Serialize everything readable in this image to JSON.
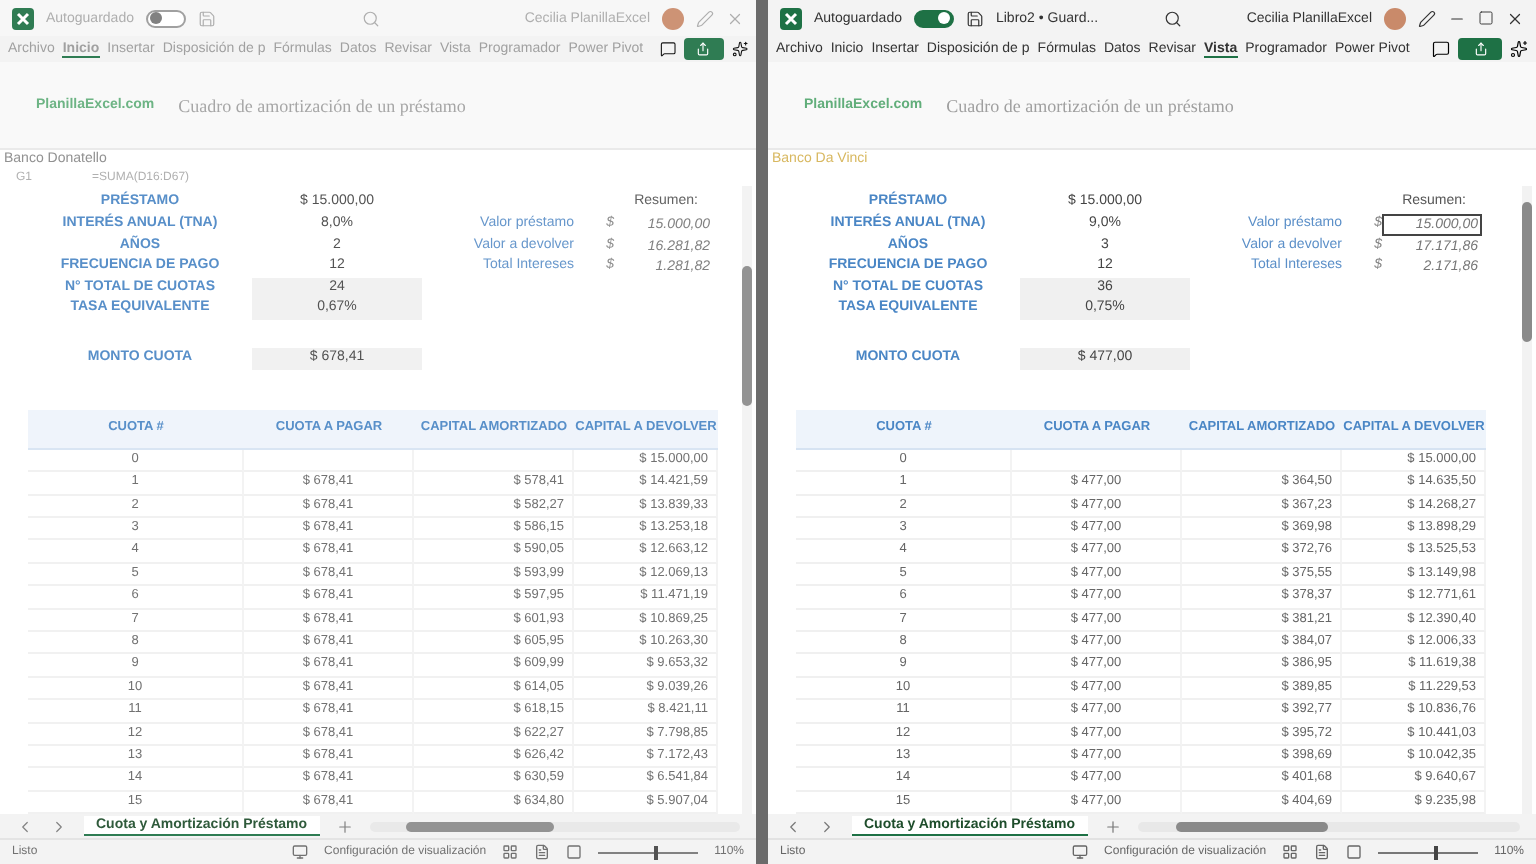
{
  "windows": [
    {
      "active": false,
      "title_bar": {
        "autosave_label": "Autoguardado",
        "autosave_on": false,
        "user_name": "Cecilia PlanillaExcel"
      },
      "ribbon_tabs": [
        {
          "label": "Archivo",
          "selected": false
        },
        {
          "label": "Inicio",
          "selected": true
        },
        {
          "label": "Insertar",
          "selected": false
        },
        {
          "label": "Disposición de p",
          "selected": false
        },
        {
          "label": "Fórmulas",
          "selected": false
        },
        {
          "label": "Datos",
          "selected": false
        },
        {
          "label": "Revisar",
          "selected": false
        },
        {
          "label": "Vista",
          "selected": false
        },
        {
          "label": "Programador",
          "selected": false
        },
        {
          "label": "Power Pivot",
          "selected": false
        }
      ],
      "ribbon": {
        "site": "PlanillaExcel.com",
        "heading": "Cuadro de amortización de un préstamo"
      },
      "bank_name": "Banco Donatello",
      "formula_bar": {
        "cell": "G1",
        "formula": "=SUMA(D16:D67)"
      },
      "loan": [
        {
          "label": "PRÉSTAMO",
          "value": "$ 15.000,00",
          "shaded": false
        },
        {
          "label": "INTERÉS ANUAL (TNA)",
          "value": "8,0%",
          "shaded": false
        },
        {
          "label": "AÑOS",
          "value": "2",
          "shaded": false
        },
        {
          "label": "FRECUENCIA DE PAGO",
          "value": "12",
          "shaded": false
        },
        {
          "label": "N° TOTAL DE CUOTAS",
          "value": "24",
          "shaded": true
        },
        {
          "label": "TASA EQUIVALENTE",
          "value": "0,67%",
          "shaded": true
        }
      ],
      "summary": {
        "title": "Resumen:",
        "items": [
          {
            "label": "Valor préstamo",
            "currency": "$",
            "value": "15.000,00",
            "selected": false
          },
          {
            "label": "Valor a devolver",
            "currency": "$",
            "value": "16.281,82",
            "selected": false
          },
          {
            "label": "Total Intereses",
            "currency": "$",
            "value": "1.281,82",
            "selected": false
          }
        ]
      },
      "payment": {
        "label": "MONTO CUOTA",
        "value": "$ 678,41"
      },
      "table": {
        "columns": [
          "CUOTA #",
          "CUOTA A PAGAR",
          "CAPITAL AMORTIZADO",
          "CAPITAL A DEVOLVER"
        ],
        "rows": [
          {
            "n": "0",
            "balance": "$ 15.000,00"
          },
          {
            "n": "1",
            "pay": "$ 678,41",
            "principal": "$ 578,41",
            "balance": "$ 14.421,59"
          },
          {
            "n": "2",
            "pay": "$ 678,41",
            "principal": "$ 582,27",
            "balance": "$ 13.839,33"
          },
          {
            "n": "3",
            "pay": "$ 678,41",
            "principal": "$ 586,15",
            "balance": "$ 13.253,18"
          },
          {
            "n": "4",
            "pay": "$ 678,41",
            "principal": "$ 590,05",
            "balance": "$ 12.663,12"
          },
          {
            "n": "5",
            "pay": "$ 678,41",
            "principal": "$ 593,99",
            "balance": "$ 12.069,13"
          },
          {
            "n": "6",
            "pay": "$ 678,41",
            "principal": "$ 597,95",
            "balance": "$ 11.471,19"
          },
          {
            "n": "7",
            "pay": "$ 678,41",
            "principal": "$ 601,93",
            "balance": "$ 10.869,25"
          },
          {
            "n": "8",
            "pay": "$ 678,41",
            "principal": "$ 605,95",
            "balance": "$ 10.263,30"
          },
          {
            "n": "9",
            "pay": "$ 678,41",
            "principal": "$ 609,99",
            "balance": "$ 9.653,32"
          },
          {
            "n": "10",
            "pay": "$ 678,41",
            "principal": "$ 614,05",
            "balance": "$ 9.039,26"
          },
          {
            "n": "11",
            "pay": "$ 678,41",
            "principal": "$ 618,15",
            "balance": "$ 8.421,11"
          },
          {
            "n": "12",
            "pay": "$ 678,41",
            "principal": "$ 622,27",
            "balance": "$ 7.798,85"
          },
          {
            "n": "13",
            "pay": "$ 678,41",
            "principal": "$ 626,42",
            "balance": "$ 7.172,43"
          },
          {
            "n": "14",
            "pay": "$ 678,41",
            "principal": "$ 630,59",
            "balance": "$ 6.541,84"
          },
          {
            "n": "15",
            "pay": "$ 678,41",
            "principal": "$ 634,80",
            "balance": "$ 5.907,04"
          }
        ]
      },
      "sheet_tab": {
        "label": "Cuota y Amortización Préstamo",
        "selected": true
      },
      "status": {
        "ready": "Listo",
        "display_settings": "Configuración de visualización",
        "zoom": {
          "level": 0.55,
          "reading": "110%"
        }
      }
    },
    {
      "active": true,
      "title_bar": {
        "autosave_label": "Autoguardado",
        "autosave_on": true,
        "file_name": "Libro2 • Guard...",
        "user_name": "Cecilia PlanillaExcel"
      },
      "ribbon_tabs": [
        {
          "label": "Archivo",
          "selected": false
        },
        {
          "label": "Inicio",
          "selected": false
        },
        {
          "label": "Insertar",
          "selected": false
        },
        {
          "label": "Disposición de p",
          "selected": false
        },
        {
          "label": "Fórmulas",
          "selected": false
        },
        {
          "label": "Datos",
          "selected": false
        },
        {
          "label": "Revisar",
          "selected": false
        },
        {
          "label": "Vista",
          "selected": true
        },
        {
          "label": "Programador",
          "selected": false
        },
        {
          "label": "Power Pivot",
          "selected": false
        }
      ],
      "ribbon": {
        "site": "PlanillaExcel.com",
        "heading": "Cuadro de amortización de un préstamo"
      },
      "bank_name": "Banco Da Vinci",
      "loan": [
        {
          "label": "PRÉSTAMO",
          "value": "$ 15.000,00",
          "shaded": false
        },
        {
          "label": "INTERÉS ANUAL (TNA)",
          "value": "9,0%",
          "shaded": false
        },
        {
          "label": "AÑOS",
          "value": "3",
          "shaded": false
        },
        {
          "label": "FRECUENCIA DE PAGO",
          "value": "12",
          "shaded": false
        },
        {
          "label": "N° TOTAL DE CUOTAS",
          "value": "36",
          "shaded": true
        },
        {
          "label": "TASA EQUIVALENTE",
          "value": "0,75%",
          "shaded": true
        }
      ],
      "summary": {
        "title": "Resumen:",
        "items": [
          {
            "label": "Valor préstamo",
            "currency": "$",
            "value": "15.000,00",
            "selected": true
          },
          {
            "label": "Valor a devolver",
            "currency": "$",
            "value": "17.171,86",
            "selected": false
          },
          {
            "label": "Total Intereses",
            "currency": "$",
            "value": "2.171,86",
            "selected": false
          }
        ]
      },
      "payment": {
        "label": "MONTO CUOTA",
        "value": "$ 477,00"
      },
      "table": {
        "columns": [
          "CUOTA #",
          "CUOTA A PAGAR",
          "CAPITAL AMORTIZADO",
          "CAPITAL A DEVOLVER"
        ],
        "rows": [
          {
            "n": "0",
            "balance": "$ 15.000,00"
          },
          {
            "n": "1",
            "pay": "$ 477,00",
            "principal": "$ 364,50",
            "balance": "$ 14.635,50"
          },
          {
            "n": "2",
            "pay": "$ 477,00",
            "principal": "$ 367,23",
            "balance": "$ 14.268,27"
          },
          {
            "n": "3",
            "pay": "$ 477,00",
            "principal": "$ 369,98",
            "balance": "$ 13.898,29"
          },
          {
            "n": "4",
            "pay": "$ 477,00",
            "principal": "$ 372,76",
            "balance": "$ 13.525,53"
          },
          {
            "n": "5",
            "pay": "$ 477,00",
            "principal": "$ 375,55",
            "balance": "$ 13.149,98"
          },
          {
            "n": "6",
            "pay": "$ 477,00",
            "principal": "$ 378,37",
            "balance": "$ 12.771,61"
          },
          {
            "n": "7",
            "pay": "$ 477,00",
            "principal": "$ 381,21",
            "balance": "$ 12.390,40"
          },
          {
            "n": "8",
            "pay": "$ 477,00",
            "principal": "$ 384,07",
            "balance": "$ 12.006,33"
          },
          {
            "n": "9",
            "pay": "$ 477,00",
            "principal": "$ 386,95",
            "balance": "$ 11.619,38"
          },
          {
            "n": "10",
            "pay": "$ 477,00",
            "principal": "$ 389,85",
            "balance": "$ 11.229,53"
          },
          {
            "n": "11",
            "pay": "$ 477,00",
            "principal": "$ 392,77",
            "balance": "$ 10.836,76"
          },
          {
            "n": "12",
            "pay": "$ 477,00",
            "principal": "$ 395,72",
            "balance": "$ 10.441,03"
          },
          {
            "n": "13",
            "pay": "$ 477,00",
            "principal": "$ 398,69",
            "balance": "$ 10.042,35"
          },
          {
            "n": "14",
            "pay": "$ 477,00",
            "principal": "$ 401,68",
            "balance": "$ 9.640,67"
          },
          {
            "n": "15",
            "pay": "$ 477,00",
            "principal": "$ 404,69",
            "balance": "$ 9.235,98"
          }
        ]
      },
      "sheet_tab": {
        "label": "Cuota y Amortización Préstamo",
        "selected": true
      },
      "status": {
        "ready": "Listo",
        "display_settings": "Configuración de visualización",
        "zoom": {
          "level": 0.55,
          "reading": "110%"
        }
      }
    }
  ]
}
